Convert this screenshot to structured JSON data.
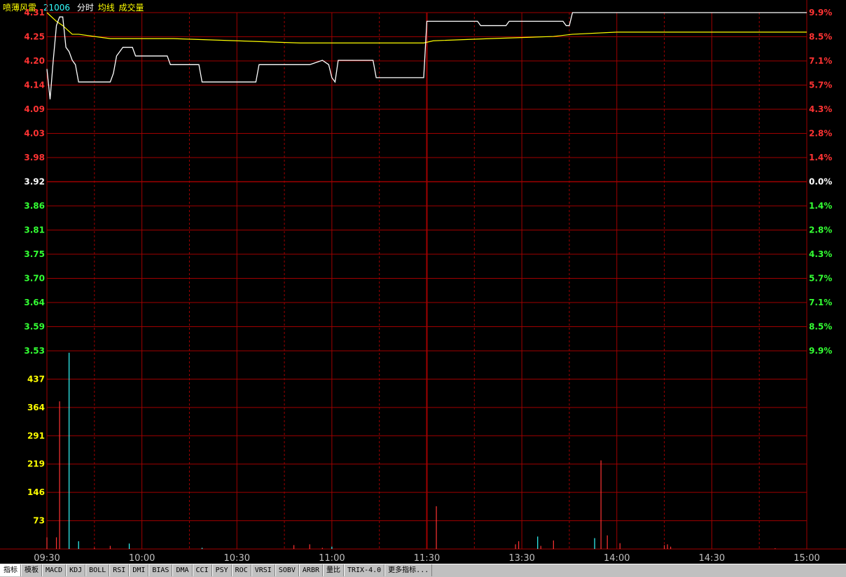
{
  "header": {
    "stock_name": "喷薄风雷",
    "code": "21006",
    "label_intraday": "分时",
    "label_avg": "均线",
    "label_volume": "成交量"
  },
  "tabs": [
    "指标",
    "模板",
    "MACD",
    "KDJ",
    "BOLL",
    "RSI",
    "DMI",
    "BIAS",
    "DMA",
    "CCI",
    "PSY",
    "ROC",
    "VRSI",
    "SOBV",
    "ARBR",
    "量比",
    "TRIX-4.0",
    "更多指标..."
  ],
  "colors": {
    "up": "#ff3333",
    "down": "#33ff33",
    "flat": "#ffffff",
    "grid": "#a00000",
    "price_line": "#ffffff",
    "avg_line": "#ffff00",
    "volume_up": "#ff3333",
    "volume_down": "#33ffff",
    "volume_axis": "#ffff00"
  },
  "chart_data": {
    "type": "line",
    "prev_close": 3.92,
    "price_axis": [
      "4.31",
      "4.25",
      "4.20",
      "4.14",
      "4.09",
      "4.03",
      "3.98",
      "3.92",
      "3.86",
      "3.81",
      "3.75",
      "3.70",
      "3.64",
      "3.59",
      "3.53"
    ],
    "pct_axis": [
      "9.9%",
      "8.5%",
      "7.1%",
      "5.7%",
      "4.3%",
      "2.8%",
      "1.4%",
      "0.0%",
      "1.4%",
      "2.8%",
      "4.3%",
      "5.7%",
      "7.1%",
      "8.5%",
      "9.9%"
    ],
    "volume_axis": [
      "437",
      "364",
      "291",
      "219",
      "146",
      "73"
    ],
    "time_labels": [
      "09:30",
      "10:00",
      "10:30",
      "11:00",
      "11:30",
      "13:30",
      "14:00",
      "14:30",
      "15:00"
    ],
    "ylim": [
      3.53,
      4.31
    ],
    "volume_max": 510,
    "price_series": [
      [
        0,
        4.18
      ],
      [
        1,
        4.11
      ],
      [
        2,
        4.2
      ],
      [
        3,
        4.28
      ],
      [
        4,
        4.3
      ],
      [
        5,
        4.3
      ],
      [
        6,
        4.23
      ],
      [
        7,
        4.22
      ],
      [
        8,
        4.2
      ],
      [
        9,
        4.19
      ],
      [
        10,
        4.15
      ],
      [
        20,
        4.15
      ],
      [
        21,
        4.17
      ],
      [
        22,
        4.21
      ],
      [
        23,
        4.22
      ],
      [
        24,
        4.23
      ],
      [
        27,
        4.23
      ],
      [
        28,
        4.21
      ],
      [
        38,
        4.21
      ],
      [
        39,
        4.19
      ],
      [
        48,
        4.19
      ],
      [
        49,
        4.15
      ],
      [
        66,
        4.15
      ],
      [
        67,
        4.19
      ],
      [
        82,
        4.19
      ],
      [
        83,
        4.19
      ],
      [
        87,
        4.2
      ],
      [
        89,
        4.19
      ],
      [
        90,
        4.16
      ],
      [
        91,
        4.15
      ],
      [
        92,
        4.2
      ],
      [
        103,
        4.2
      ],
      [
        104,
        4.16
      ],
      [
        119,
        4.16
      ],
      [
        120,
        4.29
      ],
      [
        136,
        4.29
      ],
      [
        137,
        4.28
      ],
      [
        138,
        4.28
      ],
      [
        139,
        4.28
      ],
      [
        145,
        4.28
      ],
      [
        146,
        4.29
      ],
      [
        151,
        4.29
      ],
      [
        154,
        4.29
      ],
      [
        163,
        4.29
      ],
      [
        164,
        4.28
      ],
      [
        165,
        4.28
      ],
      [
        166,
        4.31
      ],
      [
        240,
        4.31
      ],
      [
        240,
        4.31
      ]
    ],
    "avg_series": [
      [
        0,
        4.31
      ],
      [
        3,
        4.29
      ],
      [
        5,
        4.28
      ],
      [
        8,
        4.26
      ],
      [
        10,
        4.26
      ],
      [
        20,
        4.25
      ],
      [
        40,
        4.25
      ],
      [
        60,
        4.245
      ],
      [
        80,
        4.24
      ],
      [
        90,
        4.24
      ],
      [
        103,
        4.24
      ],
      [
        119,
        4.24
      ],
      [
        122,
        4.245
      ],
      [
        140,
        4.25
      ],
      [
        160,
        4.255
      ],
      [
        166,
        4.26
      ],
      [
        180,
        4.265
      ],
      [
        200,
        4.265
      ],
      [
        240,
        4.265
      ]
    ],
    "volume_series": [
      {
        "t": 0,
        "v": 30,
        "dir": "up"
      },
      {
        "t": 3,
        "v": 30,
        "dir": "up"
      },
      {
        "t": 4,
        "v": 380,
        "dir": "up"
      },
      {
        "t": 7,
        "v": 505,
        "dir": "down"
      },
      {
        "t": 10,
        "v": 20,
        "dir": "down"
      },
      {
        "t": 15,
        "v": 3,
        "dir": "up"
      },
      {
        "t": 20,
        "v": 8,
        "dir": "up"
      },
      {
        "t": 26,
        "v": 14,
        "dir": "down"
      },
      {
        "t": 49,
        "v": 3,
        "dir": "down"
      },
      {
        "t": 78,
        "v": 10,
        "dir": "up"
      },
      {
        "t": 83,
        "v": 12,
        "dir": "up"
      },
      {
        "t": 87,
        "v": 3,
        "dir": "up"
      },
      {
        "t": 90,
        "v": 6,
        "dir": "down"
      },
      {
        "t": 123,
        "v": 110,
        "dir": "up"
      },
      {
        "t": 148,
        "v": 12,
        "dir": "up"
      },
      {
        "t": 149,
        "v": 20,
        "dir": "up"
      },
      {
        "t": 155,
        "v": 32,
        "dir": "down"
      },
      {
        "t": 156,
        "v": 8,
        "dir": "up"
      },
      {
        "t": 160,
        "v": 22,
        "dir": "up"
      },
      {
        "t": 173,
        "v": 28,
        "dir": "down"
      },
      {
        "t": 175,
        "v": 228,
        "dir": "up"
      },
      {
        "t": 177,
        "v": 35,
        "dir": "up"
      },
      {
        "t": 181,
        "v": 15,
        "dir": "up"
      },
      {
        "t": 195,
        "v": 10,
        "dir": "up"
      },
      {
        "t": 196,
        "v": 12,
        "dir": "up"
      },
      {
        "t": 197,
        "v": 6,
        "dir": "up"
      },
      {
        "t": 230,
        "v": 2,
        "dir": "up"
      }
    ]
  }
}
